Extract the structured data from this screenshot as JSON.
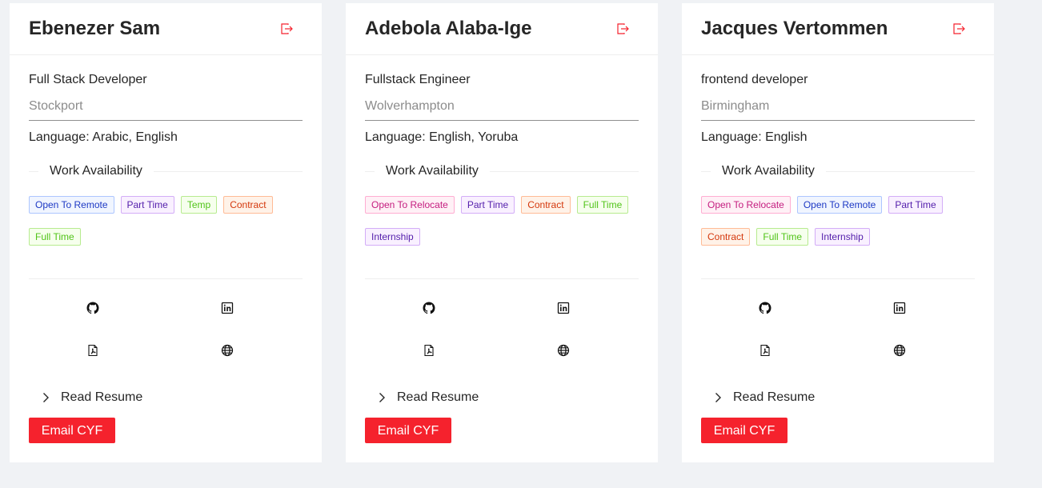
{
  "colors": {
    "accent_red": "#f5222d",
    "page_bg": "#f0f2f5",
    "card_bg": "#ffffff"
  },
  "cards": [
    {
      "name": "Ebenezer Sam",
      "role": "Full Stack Developer",
      "city": "Stockport",
      "language": "Language: Arabic, English",
      "availability_title": "Work Availability",
      "tags": [
        {
          "label": "Open To Remote",
          "color": "blue"
        },
        {
          "label": "Part Time",
          "color": "purple"
        },
        {
          "label": "Temp",
          "color": "green"
        },
        {
          "label": "Contract",
          "color": "volcano"
        },
        {
          "label": "Full Time",
          "color": "green"
        }
      ],
      "icons": [
        "github-icon",
        "linkedin-icon",
        "pdf-icon",
        "globe-icon",
        "logout-icon"
      ],
      "read_resume": "Read Resume",
      "email_button": "Email CYF"
    },
    {
      "name": "Adebola Alaba-Ige",
      "role": "Fullstack Engineer",
      "city": "Wolverhampton",
      "language": "Language: English, Yoruba",
      "availability_title": "Work Availability",
      "tags": [
        {
          "label": "Open To Relocate",
          "color": "magenta"
        },
        {
          "label": "Part Time",
          "color": "purple"
        },
        {
          "label": "Contract",
          "color": "volcano"
        },
        {
          "label": "Full Time",
          "color": "green"
        },
        {
          "label": "Internship",
          "color": "purple"
        }
      ],
      "icons": [
        "github-icon",
        "linkedin-icon",
        "pdf-icon",
        "globe-icon",
        "logout-icon"
      ],
      "read_resume": "Read Resume",
      "email_button": "Email CYF"
    },
    {
      "name": "Jacques Vertommen",
      "role": "frontend developer",
      "city": "Birmingham",
      "language": "Language: English",
      "availability_title": "Work Availability",
      "tags": [
        {
          "label": "Open To Relocate",
          "color": "magenta"
        },
        {
          "label": "Open To Remote",
          "color": "blue"
        },
        {
          "label": "Part Time",
          "color": "purple"
        },
        {
          "label": "Contract",
          "color": "volcano"
        },
        {
          "label": "Full Time",
          "color": "green"
        },
        {
          "label": "Internship",
          "color": "purple"
        }
      ],
      "icons": [
        "github-icon",
        "linkedin-icon",
        "pdf-icon",
        "globe-icon",
        "logout-icon"
      ],
      "read_resume": "Read Resume",
      "email_button": "Email CYF"
    }
  ]
}
